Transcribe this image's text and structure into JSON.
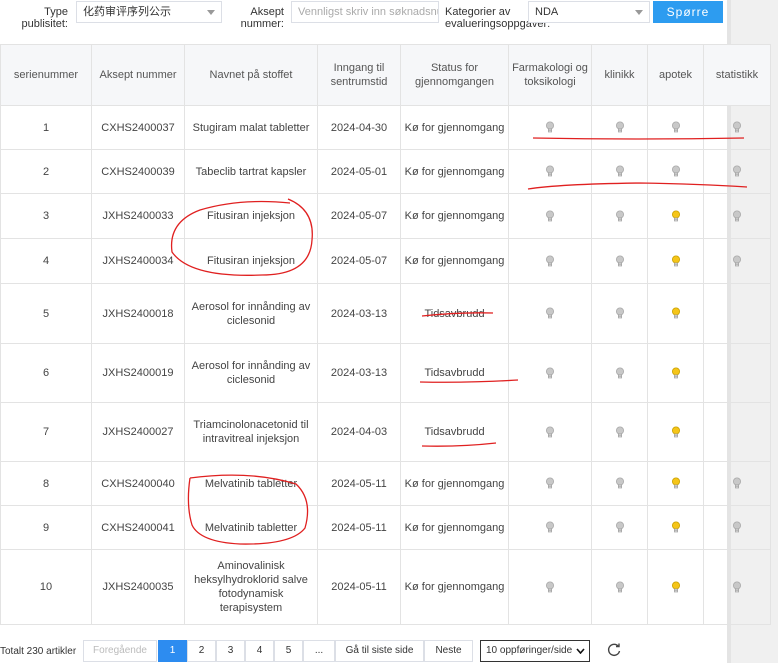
{
  "filters": {
    "type_label": "Type publisitet:",
    "type_value": "化药审评序列公示",
    "accept_label": "Aksept nummer:",
    "accept_placeholder": "Vennligst skriv inn søknadsnummer",
    "category_label": "Kategorier av evalueringsoppgaver:",
    "category_value": "NDA",
    "query_button": "Spørre"
  },
  "table": {
    "headers": [
      "serienummer",
      "Aksept nummer",
      "Navnet på stoffet",
      "Inngang til sentrumstid",
      "Status for gjennomgangen",
      "Farmakologi og toksikologi",
      "klinikk",
      "apotek",
      "statistikk"
    ],
    "rows": [
      {
        "no": "1",
        "accept": "CXHS2400037",
        "name": "Stugiram malat tabletter",
        "date": "2024-04-30",
        "status": "Kø for gjennomgang",
        "bulbs": [
          "grey",
          "grey",
          "grey",
          "grey"
        ]
      },
      {
        "no": "2",
        "accept": "CXHS2400039",
        "name": "Tabeclib tartrat kapsler",
        "date": "2024-05-01",
        "status": "Kø for gjennomgang",
        "bulbs": [
          "grey",
          "grey",
          "grey",
          "grey"
        ]
      },
      {
        "no": "3",
        "accept": "JXHS2400033",
        "name": "Fitusiran injeksjon",
        "date": "2024-05-07",
        "status": "Kø for gjennomgang",
        "bulbs": [
          "grey",
          "grey",
          "yellow",
          "grey"
        ]
      },
      {
        "no": "4",
        "accept": "JXHS2400034",
        "name": "Fitusiran injeksjon",
        "date": "2024-05-07",
        "status": "Kø for gjennomgang",
        "bulbs": [
          "grey",
          "grey",
          "yellow",
          "grey"
        ]
      },
      {
        "no": "5",
        "accept": "JXHS2400018",
        "name": "Aerosol for innånding av ciclesonid",
        "date": "2024-03-13",
        "status": "Tidsavbrudd",
        "bulbs": [
          "grey",
          "grey",
          "yellow",
          ""
        ]
      },
      {
        "no": "6",
        "accept": "JXHS2400019",
        "name": "Aerosol for innånding av ciclesonid",
        "date": "2024-03-13",
        "status": "Tidsavbrudd",
        "bulbs": [
          "grey",
          "grey",
          "yellow",
          ""
        ]
      },
      {
        "no": "7",
        "accept": "JXHS2400027",
        "name": "Triamcinolonacetonid til intravitreal injeksjon",
        "date": "2024-04-03",
        "status": "Tidsavbrudd",
        "bulbs": [
          "grey",
          "grey",
          "yellow",
          ""
        ]
      },
      {
        "no": "8",
        "accept": "CXHS2400040",
        "name": "Melvatinib tabletter",
        "date": "2024-05-11",
        "status": "Kø for gjennomgang",
        "bulbs": [
          "grey",
          "grey",
          "yellow",
          "grey"
        ]
      },
      {
        "no": "9",
        "accept": "CXHS2400041",
        "name": "Melvatinib tabletter",
        "date": "2024-05-11",
        "status": "Kø for gjennomgang",
        "bulbs": [
          "grey",
          "grey",
          "yellow",
          "grey"
        ]
      },
      {
        "no": "10",
        "accept": "JXHS2400035",
        "name": "Aminovalinisk heksylhydroklorid salve fotodynamisk terapisystem",
        "date": "2024-05-11",
        "status": "Kø for gjennomgang",
        "bulbs": [
          "grey",
          "grey",
          "yellow",
          "grey"
        ]
      }
    ]
  },
  "pagination": {
    "total": "Totalt 230 artikler",
    "prev": "Foregående",
    "pages": [
      "1",
      "2",
      "3",
      "4",
      "5",
      "..."
    ],
    "active_page": "1",
    "last": "Gå til siste side",
    "next": "Neste",
    "page_size": "10 oppføringer/side"
  },
  "colors": {
    "accent": "#2d8cf0",
    "annotation": "#e02020",
    "bulb_grey": "#c8c8c8",
    "bulb_yellow": "#f5c518"
  }
}
